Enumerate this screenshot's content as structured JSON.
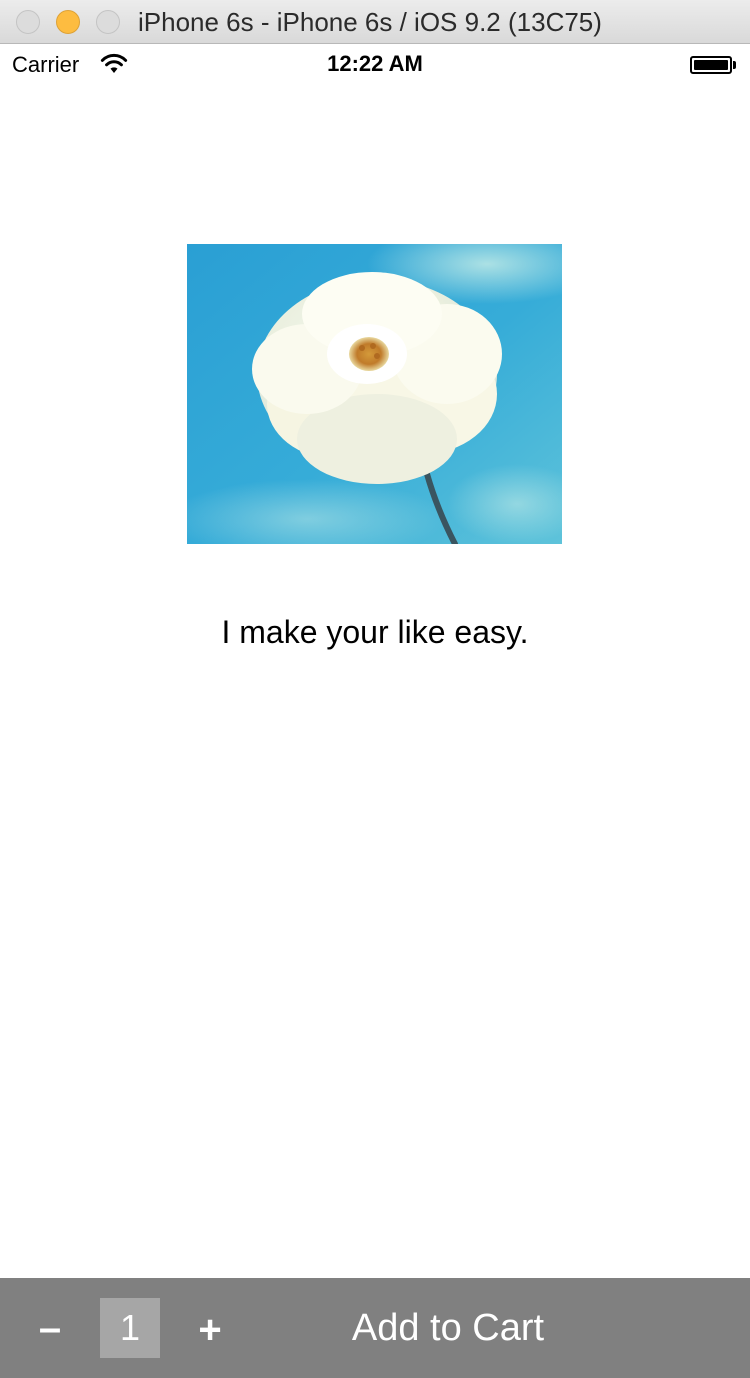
{
  "window": {
    "title": "iPhone 6s - iPhone 6s / iOS 9.2 (13C75)",
    "buttons": [
      "close",
      "minimize",
      "zoom"
    ]
  },
  "status_bar": {
    "carrier": "Carrier",
    "time": "12:22 AM",
    "wifi_icon": "wifi-icon",
    "battery_icon": "battery-icon"
  },
  "product": {
    "image": "white-flower-on-blue-sky-photo",
    "tagline": "I make your like easy."
  },
  "cart_bar": {
    "minus_label": "–",
    "quantity": "1",
    "plus_label": "+",
    "add_label": "Add to Cart"
  },
  "colors": {
    "toolbar_bg": "#808080",
    "quantity_bg": "#a6a6a6",
    "minimize_button": "#fdbc40"
  }
}
